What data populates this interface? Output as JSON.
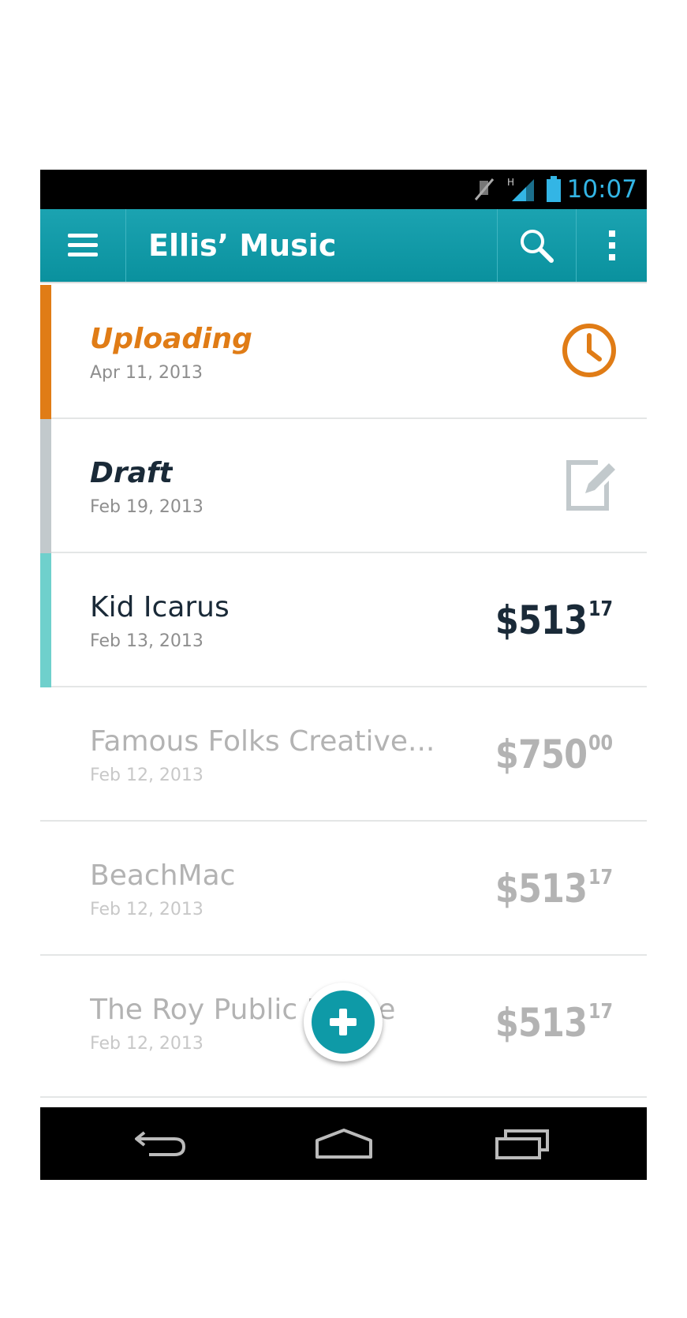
{
  "status_bar": {
    "time": "10:07",
    "network_label": "H",
    "icons": [
      "mute-icon",
      "signal-icon",
      "battery-icon"
    ]
  },
  "action_bar": {
    "title": "Ellis’ Music",
    "icons": [
      "menu-icon",
      "search-icon",
      "overflow-menu-icon"
    ]
  },
  "items": [
    {
      "title": "Uploading",
      "date": "Apr 11, 2013",
      "state": "uploading",
      "accent": "#e07c16",
      "icon": "clock-icon"
    },
    {
      "title": "Draft",
      "date": "Feb 19, 2013",
      "state": "draft",
      "accent": "#c2c9cc",
      "icon": "edit-icon"
    },
    {
      "title": "Kid Icarus",
      "date": "Feb 13, 2013",
      "amount": "$513",
      "cents": "17",
      "state": "active",
      "accent": "#6fd0cc"
    },
    {
      "title": "Famous Folks Creative...",
      "date": "Feb 12, 2013",
      "amount": "$750",
      "cents": "00",
      "state": "inactive"
    },
    {
      "title": "BeachMac",
      "date": "Feb 12, 2013",
      "amount": "$513",
      "cents": "17",
      "state": "inactive"
    },
    {
      "title": "The Roy Public House",
      "date": "Feb 12, 2013",
      "amount": "$513",
      "cents": "17",
      "state": "inactive"
    }
  ],
  "fab": {
    "icon": "plus-icon"
  },
  "nav_bar": {
    "icons": [
      "back-icon",
      "home-icon",
      "recents-icon"
    ]
  },
  "colors": {
    "accent_teal": "#0e9aa7",
    "uploading_orange": "#e07c16",
    "status_time_blue": "#33b5e5"
  }
}
